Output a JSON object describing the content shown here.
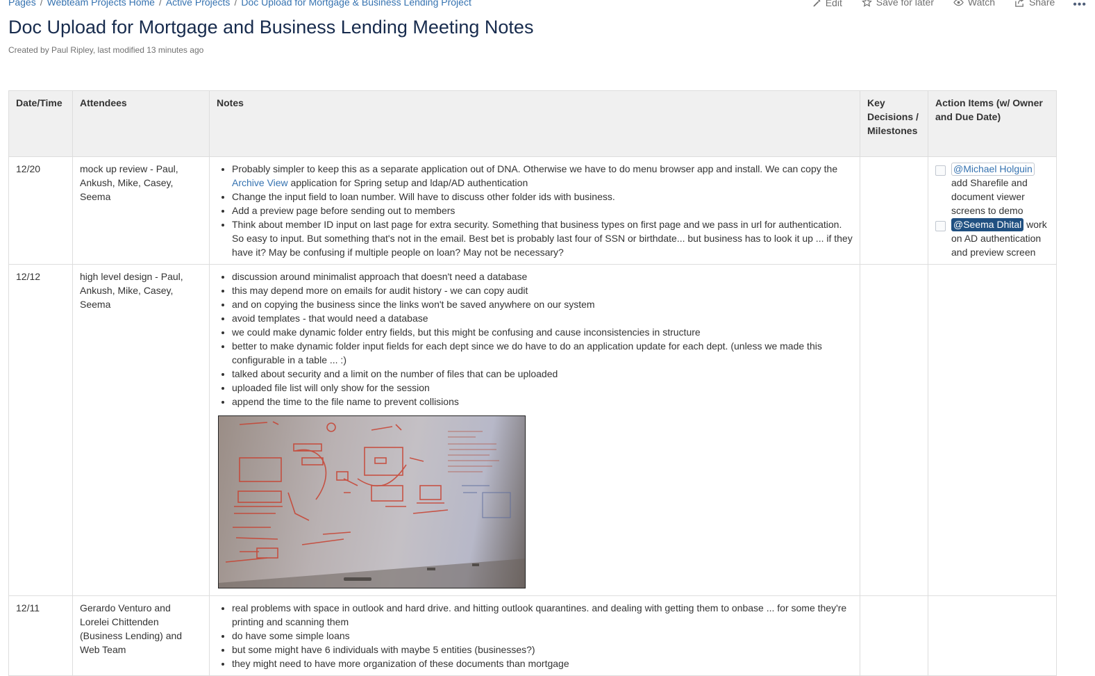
{
  "breadcrumbs": [
    "Pages",
    "Webteam Projects Home",
    "Active Projects",
    "Doc Upload for Mortgage & Business Lending Project"
  ],
  "page_actions": {
    "edit": "Edit",
    "save_for_later": "Save for later",
    "watch": "Watch",
    "share": "Share",
    "more": "•••"
  },
  "page": {
    "title": "Doc Upload for Mortgage and Business Lending Meeting Notes",
    "byline_prefix": "Created by ",
    "author": "Paul Ripley",
    "byline_mid": ", last modified ",
    "modified": "13 minutes ago"
  },
  "table": {
    "headers": {
      "date": "Date/Time",
      "attendees": "Attendees",
      "notes": "Notes",
      "decisions": "Key Decisions / Milestones",
      "actions": "Action Items (w/ Owner and Due Date)"
    },
    "rows": [
      {
        "date": "12/20",
        "attendees": "mock up review - Paul, Ankush, Mike, Casey, Seema",
        "notes": {
          "n0_pre": "Probably simpler to keep this as a separate application out of DNA.  Otherwise we have to do menu browser app and install.  We can copy the ",
          "n0_link": "Archive View",
          "n0_post": " application for Spring setup and ldap/AD authentication",
          "n1": "Change the input field to loan number.  Will have to discuss other folder ids with business.",
          "n2": "Add a preview page before sending out to members",
          "n3": "Think about member ID input on last page for extra security.  Something that business types on first page and we pass in url for authentication.  So easy to input.  But something that's not in the email.  Best bet is probably last four of SSN or birthdate... but business has to look it up ... if they have it?  May be confusing if multiple people on loan?  May not be necessary?"
        },
        "tasks": [
          {
            "mention": "@Michael Holguin",
            "text": " add Sharefile and document viewer screens to demo"
          },
          {
            "mention": "@Seema Dhital",
            "text": " work on AD authentication and preview screen"
          }
        ]
      },
      {
        "date": "12/12",
        "attendees": "high level design - Paul, Ankush, Mike, Casey, Seema",
        "notes": [
          "discussion around minimalist approach that doesn't need a database",
          "this may depend more on emails for audit history - we can copy audit",
          "and on copying the business since the links won't be saved anywhere on our system",
          "avoid templates - that would need a database",
          "we could make dynamic folder entry fields, but this might be confusing and cause inconsistencies in structure",
          "better to make dynamic folder input fields for each dept since we do have to do an application update for each dept.  (unless we made this configurable in a table ... :)",
          "talked about security and a limit on the number of files that can be uploaded",
          "uploaded file list will only show for the session",
          "append the time to the file name to prevent collisions"
        ]
      },
      {
        "date": "12/11",
        "attendees": "Gerardo Venturo and Lorelei Chittenden (Business Lending) and Web Team",
        "notes": [
          "real problems with space in outlook and hard drive.  and hitting outlook quarantines.  and dealing with getting them to onbase ... for some they're printing and scanning them",
          "do have some simple loans",
          "but some might have 6 individuals with maybe 5 entities (businesses?)",
          "they might need to have more organization of these documents than mortgage"
        ]
      }
    ]
  },
  "colors": {
    "link": "#3572b0",
    "header_bg": "#f0f0f0",
    "border": "#dddddd",
    "mention_me": "#205081"
  },
  "icons": [
    "pencil-icon",
    "star-icon",
    "eye-icon",
    "share-icon",
    "more-icon"
  ]
}
